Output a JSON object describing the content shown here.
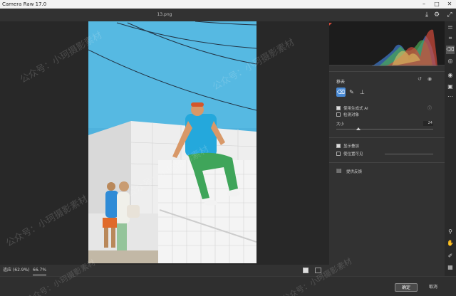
{
  "window": {
    "title": "Camera Raw 17.0",
    "minimize": "–",
    "maximize": "□",
    "close": "✕"
  },
  "header": {
    "filename": "13.png"
  },
  "panel": {
    "title": "移去",
    "generative_ai_label": "使用生成式 AI",
    "detect_objects_label": "检测对象",
    "size_label": "大小",
    "size_value": "24",
    "show_overlay_label": "显示叠加",
    "visualize_spots_label": "使位置可见",
    "feedback_label": "提供反馈"
  },
  "statusbar": {
    "fit_label": "适应 (62.9%)",
    "zoom_label": "66.7%"
  },
  "footer": {
    "ok_label": "确定",
    "cancel_label": "取消"
  },
  "watermark": {
    "text": "公众号：小珂摄影素材"
  },
  "icons": [
    "export-icon",
    "settings-icon",
    "expand-icon",
    "edit-icon",
    "crop-icon",
    "remove-icon",
    "mask-icon",
    "redeye-icon",
    "presets-icon",
    "more-icon",
    "zoom-icon",
    "hand-icon",
    "color-sampler-icon",
    "grid-icon"
  ],
  "colors": {
    "accent": "#4a8bd6",
    "panel_bg": "#323232",
    "canvas_bg": "#282828",
    "histogram_red": "#d24a3a",
    "histogram_green": "#4caa56",
    "histogram_blue": "#3f7bd0"
  }
}
